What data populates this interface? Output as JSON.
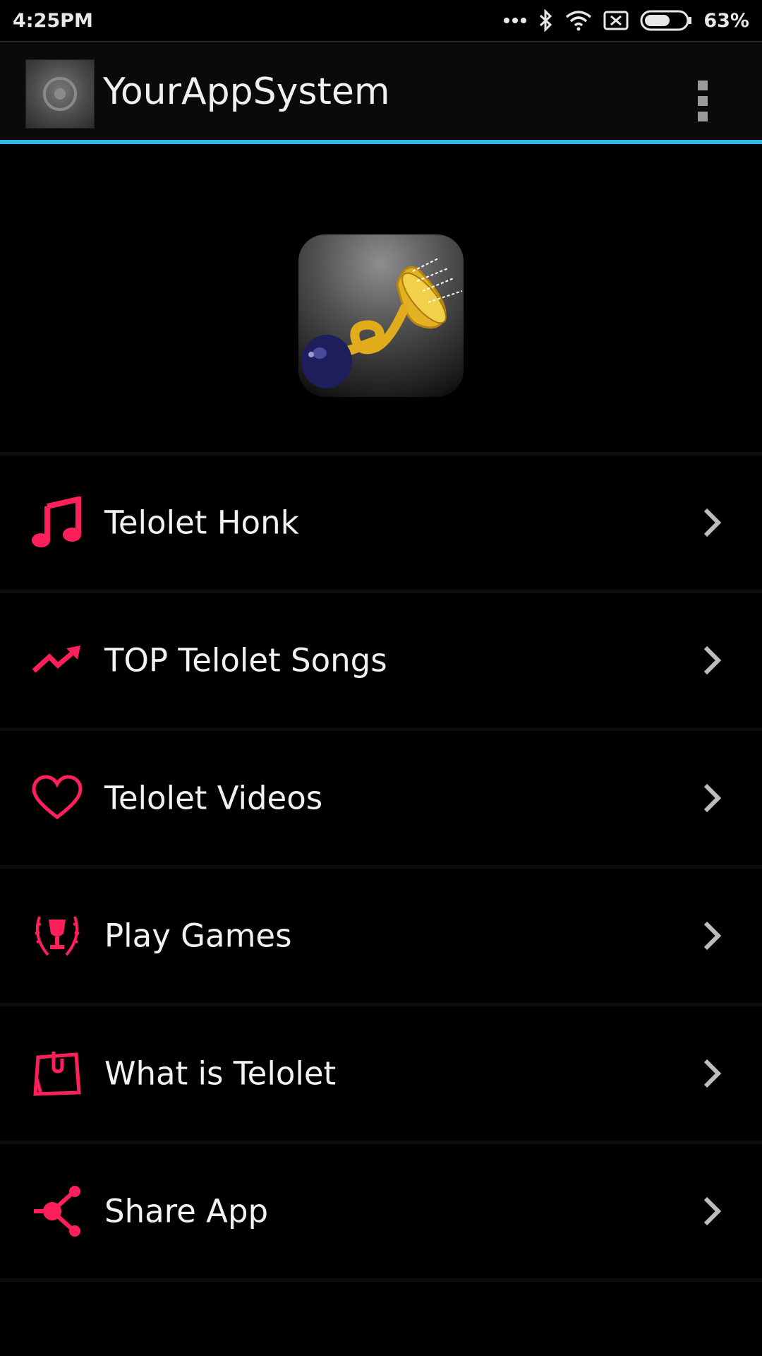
{
  "status_bar": {
    "time": "4:25PM",
    "battery_percent": "63%",
    "battery_level": 0.63,
    "icons": [
      "more-dots-icon",
      "bluetooth-icon",
      "wifi-icon",
      "no-sim-icon",
      "battery-icon"
    ]
  },
  "app_bar": {
    "title": "YourAppSystem",
    "logo_icon": "app-logo-icon",
    "overflow_icon": "overflow-menu-icon"
  },
  "hero": {
    "icon": "telolet-horn-icon"
  },
  "colors": {
    "accent_line": "#33b5e5",
    "menu_icon": "#ff1f5a",
    "background": "#000000",
    "text": "#f2f2f2",
    "chevron": "#bdbdbd"
  },
  "menu": {
    "items": [
      {
        "label": "Telolet Honk",
        "icon": "music-note-icon"
      },
      {
        "label": "TOP Telolet Songs",
        "icon": "trending-up-icon"
      },
      {
        "label": "Telolet Videos",
        "icon": "heart-icon"
      },
      {
        "label": "Play Games",
        "icon": "trophy-icon"
      },
      {
        "label": "What is Telolet",
        "icon": "note-pin-icon"
      },
      {
        "label": "Share App",
        "icon": "share-icon"
      }
    ],
    "chevron_icon": "chevron-right-icon"
  }
}
